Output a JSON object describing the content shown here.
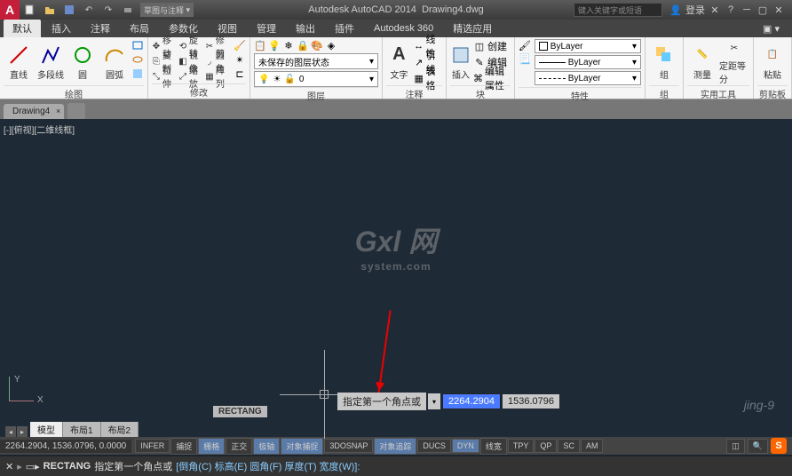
{
  "title_app": "Autodesk AutoCAD 2014",
  "title_file": "Drawing4.dwg",
  "qat_dropdown": "草图与注释",
  "search_placeholder": "键入关键字或短语",
  "login_label": "登录",
  "menu": {
    "default": "默认",
    "insert": "插入",
    "annotate": "注释",
    "layout": "布局",
    "param": "参数化",
    "view": "视图",
    "manage": "管理",
    "output": "输出",
    "plugins": "插件",
    "a360": "Autodesk 360",
    "express": "精选应用"
  },
  "ribbon": {
    "draw": {
      "label": "绘图",
      "line": "直线",
      "polyline": "多段线",
      "circle": "圆",
      "arc": "圆弧"
    },
    "modify": {
      "label": "修改",
      "move": "移动",
      "rotate": "旋转",
      "trim": "修剪",
      "copy": "复制",
      "mirror": "镜像",
      "fillet": "圆角",
      "stretch": "拉伸",
      "scale": "缩放",
      "array": "阵列"
    },
    "layer": {
      "label": "图层",
      "unsaved": "未保存的图层状态",
      "layer0": "0"
    },
    "anno": {
      "label": "注释",
      "text": "文字",
      "linetype": "线性",
      "leader": "引线",
      "table": "表格"
    },
    "block": {
      "label": "块",
      "insert": "插入",
      "create": "创建",
      "edit": "编辑",
      "editattr": "编辑属性"
    },
    "prop": {
      "label": "特性",
      "bylayer": "ByLayer"
    },
    "group": {
      "label": "组",
      "group": "组"
    },
    "util": {
      "label": "实用工具",
      "measure": "测量",
      "dist": "定距等分"
    },
    "clip": {
      "label": "剪贴板",
      "paste": "粘贴"
    }
  },
  "filetab": "Drawing4",
  "viewport_label": "[-][俯视][二维线框]",
  "watermark_main": "Gxl 网",
  "watermark_sub": "system.com",
  "watermark_br": "jing-9",
  "dyn_prompt": "指定第一个角点或",
  "dyn_x": "2264.2904",
  "dyn_y": "1536.0796",
  "ucs": {
    "x": "X",
    "y": "Y"
  },
  "cmd_tag": "RECTANG",
  "cmd_prefix": "RECTANG",
  "cmd_text": "指定第一个角点或",
  "cmd_opts": "[倒角(C) 标高(E) 圆角(F) 厚度(T) 宽度(W)]:",
  "layout": {
    "model": "模型",
    "l1": "布局1",
    "l2": "布局2"
  },
  "coords": "2264.2904, 1536.0796, 0.0000",
  "status": {
    "infer": "INFER",
    "snap": "捕捉",
    "grid": "栅格",
    "ortho": "正交",
    "polar": "极轴",
    "osnap": "对象捕捉",
    "_3dosnap": "3DOSNAP",
    "otrack": "对象追踪",
    "ducs": "DUCS",
    "dyn": "DYN",
    "lwt": "线宽",
    "tpy": "TPY",
    "qp": "QP",
    "sc": "SC",
    "am": "AM"
  }
}
